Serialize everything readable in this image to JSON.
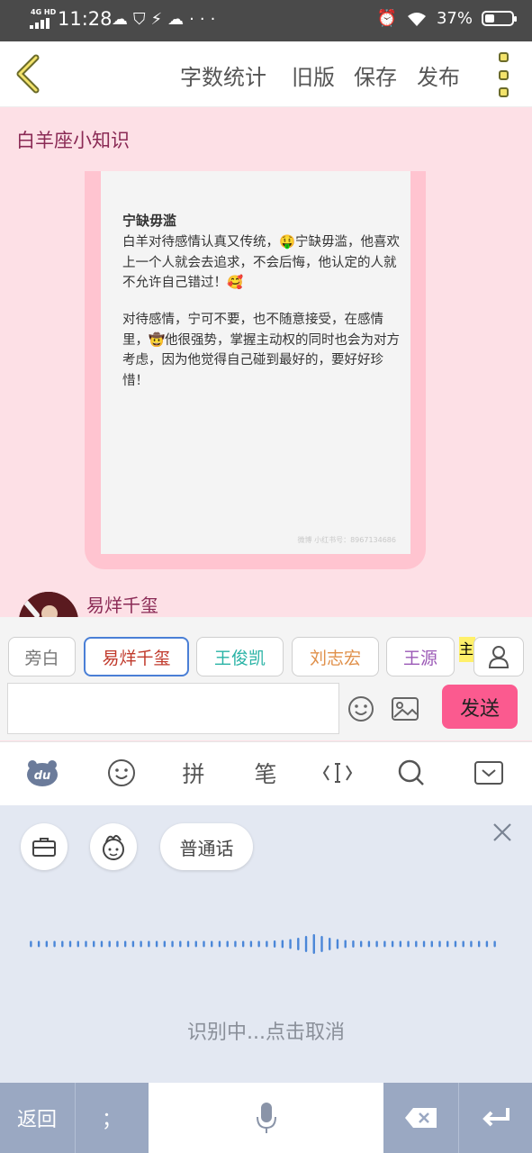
{
  "status": {
    "network": "4G HD",
    "time": "11:28",
    "battery_text": "37%",
    "battery_level": 0.37
  },
  "toolbar": {
    "word_count": "字数统计",
    "old_version": "旧版",
    "save": "保存",
    "publish": "发布"
  },
  "post": {
    "section_title": "白羊座小知识",
    "image": {
      "heading": "宁缺毋滥",
      "para1": "白羊对待感情认真又传统，🤑宁缺毋滥，他喜欢上一个人就会去追求，不会后悔，他认定的人就不允许自己错过！🥰",
      "para2": "对待感情，宁可不要，也不随意接受，在感情里，🤠他很强势，掌握主动权的同时也会为对方考虑，因为他觉得自己碰到最好的，要好好珍惜！",
      "watermark": "微博 小红书号：8967134686"
    },
    "author_name": "易烊千玺"
  },
  "roles": [
    {
      "label": "旁白",
      "color": "#777777",
      "border": "#cfcfcf"
    },
    {
      "label": "易烊千玺",
      "color": "#c0392b",
      "border": "#4a7fd6"
    },
    {
      "label": "王俊凯",
      "color": "#2ab3a6",
      "border": "#cfcfcf"
    },
    {
      "label": "刘志宏",
      "color": "#e0904a",
      "border": "#cfcfcf"
    },
    {
      "label": "王源",
      "color": "#9b59b6",
      "border": "#cfcfcf"
    }
  ],
  "roles_more": "主",
  "composer": {
    "send": "发送",
    "placeholder": ""
  },
  "ime": {
    "pinyin": "拼",
    "stroke": "笔",
    "mandarin": "普通话",
    "status": "识别中...点击取消",
    "back": "返回",
    "punct": "；"
  },
  "colors": {
    "accent_pink": "#fb5a8f",
    "page_bg": "#fde0e6",
    "voice_blue": "#4a86d8"
  }
}
